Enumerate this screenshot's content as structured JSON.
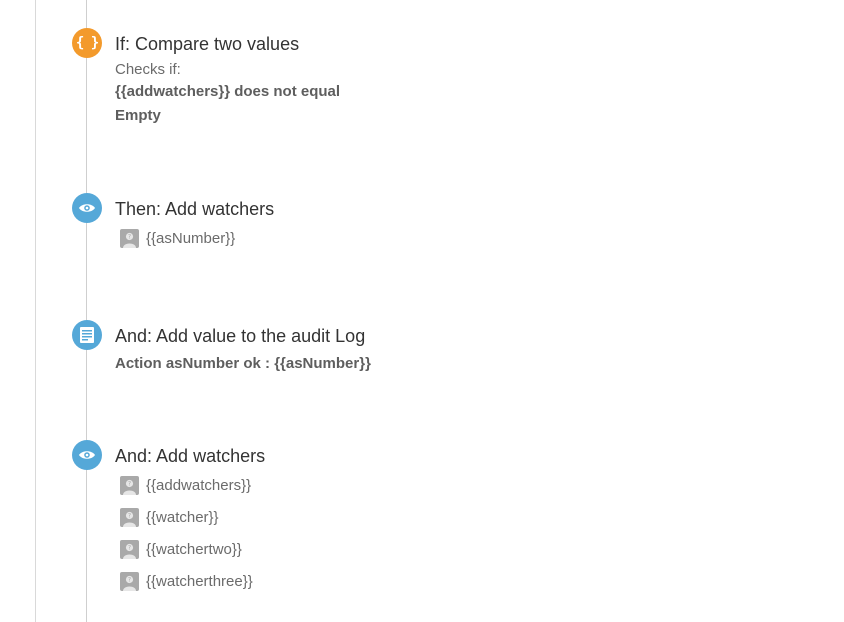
{
  "steps": {
    "if_compare": {
      "icon": "curly-braces-icon",
      "icon_color": "#f39a2c",
      "icon_glyph": "{ }",
      "title": "If: Compare two values",
      "subtitle": "Checks if:",
      "condition_line1": "{{addwatchers}} does not equal",
      "condition_line2": "Empty"
    },
    "then_add_watchers": {
      "icon": "eye-icon",
      "icon_color": "#55a8d8",
      "title": "Then: Add watchers",
      "users": [
        "{{asNumber}}"
      ]
    },
    "and_audit_log": {
      "icon": "document-lines-icon",
      "icon_color": "#55a8d8",
      "title": "And: Add value to the audit Log",
      "message": "Action asNumber ok : {{asNumber}}"
    },
    "and_add_watchers": {
      "icon": "eye-icon",
      "icon_color": "#55a8d8",
      "title": "And: Add watchers",
      "users": [
        "{{addwatchers}}",
        "{{watcher}}",
        "{{watchertwo}}",
        "{{watcherthree}}"
      ]
    }
  }
}
